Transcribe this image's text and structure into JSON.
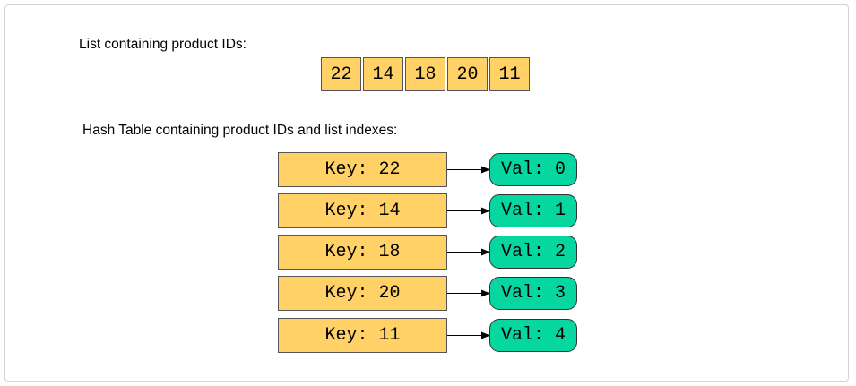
{
  "colors": {
    "key_fill": "#ffd166",
    "value_fill": "#06d6a0",
    "border": "#555555"
  },
  "list_caption": "List containing product IDs:",
  "list_items": [
    "22",
    "14",
    "18",
    "20",
    "11"
  ],
  "hash_caption": "Hash Table containing product IDs and list indexes:",
  "hash_entries": [
    {
      "key": "Key: 22",
      "value": "Val: 0"
    },
    {
      "key": "Key: 14",
      "value": "Val: 1"
    },
    {
      "key": "Key: 18",
      "value": "Val: 2"
    },
    {
      "key": "Key: 20",
      "value": "Val: 3"
    },
    {
      "key": "Key: 11",
      "value": "Val: 4"
    }
  ]
}
